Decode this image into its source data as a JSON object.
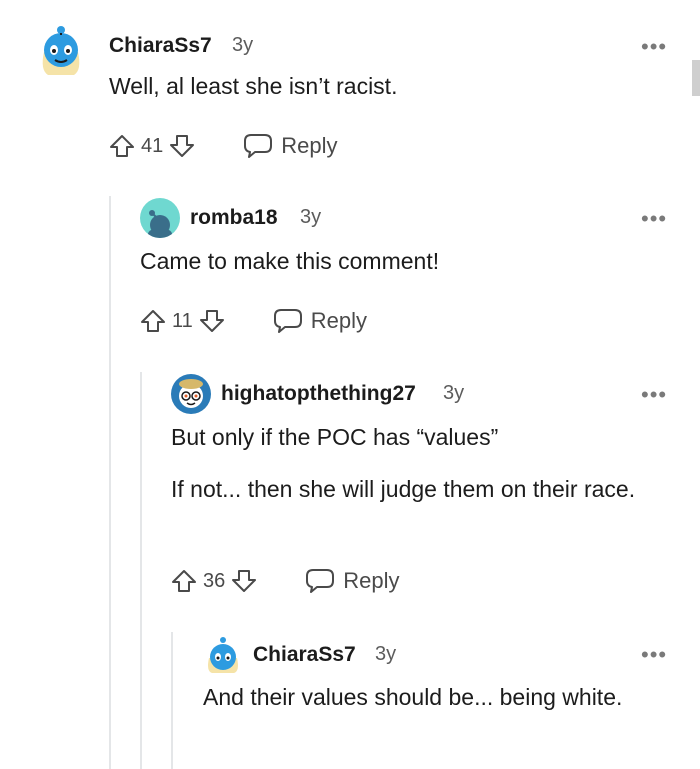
{
  "comments": [
    {
      "username": "ChiaraSs7",
      "time": "3y",
      "paragraphs": [
        "Well, al least she isn’t racist."
      ],
      "score": "41",
      "reply_label": "Reply"
    },
    {
      "username": "romba18",
      "time": "3y",
      "paragraphs": [
        "Came to make this comment!"
      ],
      "score": "11",
      "reply_label": "Reply"
    },
    {
      "username": "highatopthething27",
      "time": "3y",
      "paragraphs": [
        "But only if the POC has “values”",
        "If not... then she will judge them on their race."
      ],
      "score": "36",
      "reply_label": "Reply"
    },
    {
      "username": "ChiaraSs7",
      "time": "3y",
      "paragraphs": [
        "And their values should be... being white."
      ]
    }
  ],
  "more_icon": "more-horizontal-icon",
  "colors": {
    "text": "#1c1c1c",
    "meta": "#5c5c5c",
    "thread_line": "#e4e6e8",
    "avatar_blue": "#2d9be0"
  }
}
